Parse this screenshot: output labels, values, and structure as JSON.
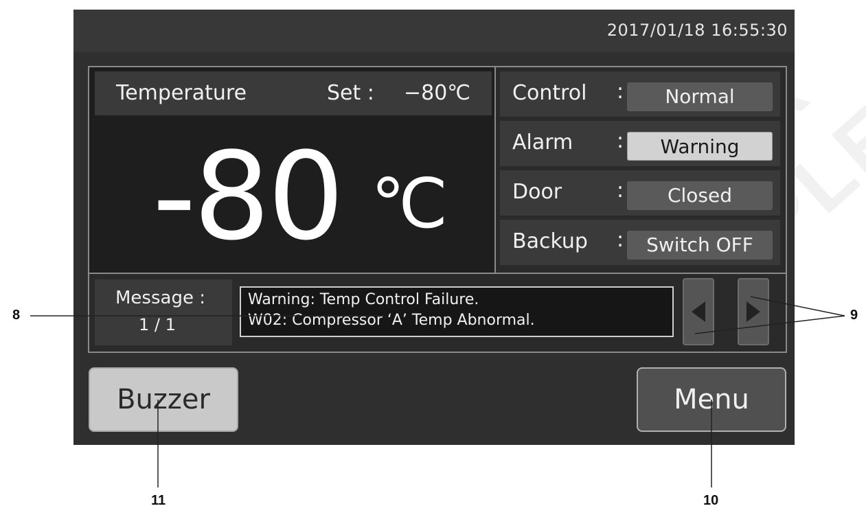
{
  "watermark": "FISHER SAMPLE",
  "header": {
    "datetime": "2017/01/18  16:55:30"
  },
  "temperature": {
    "title": "Temperature",
    "set_label": "Set :",
    "set_value": "−80℃",
    "current_value": "-80",
    "unit": "℃"
  },
  "status": {
    "rows": [
      {
        "label": "Control",
        "value": "Normal"
      },
      {
        "label": "Alarm",
        "value": "Warning"
      },
      {
        "label": "Door",
        "value": "Closed"
      },
      {
        "label": "Backup",
        "value": "Switch OFF"
      }
    ]
  },
  "message": {
    "label": "Message :",
    "count": "1 / 1",
    "lines": [
      "Warning: Temp Control Failure.",
      "W02: Compressor ‘A’ Temp Abnormal."
    ]
  },
  "buttons": {
    "buzzer": "Buzzer",
    "menu": "Menu"
  },
  "callouts": {
    "c8": "8",
    "c9": "9",
    "c10": "10",
    "c11": "11"
  },
  "colors": {
    "screen_bg": "#2f2f2f",
    "warning_highlight": "#d2d2d2"
  }
}
